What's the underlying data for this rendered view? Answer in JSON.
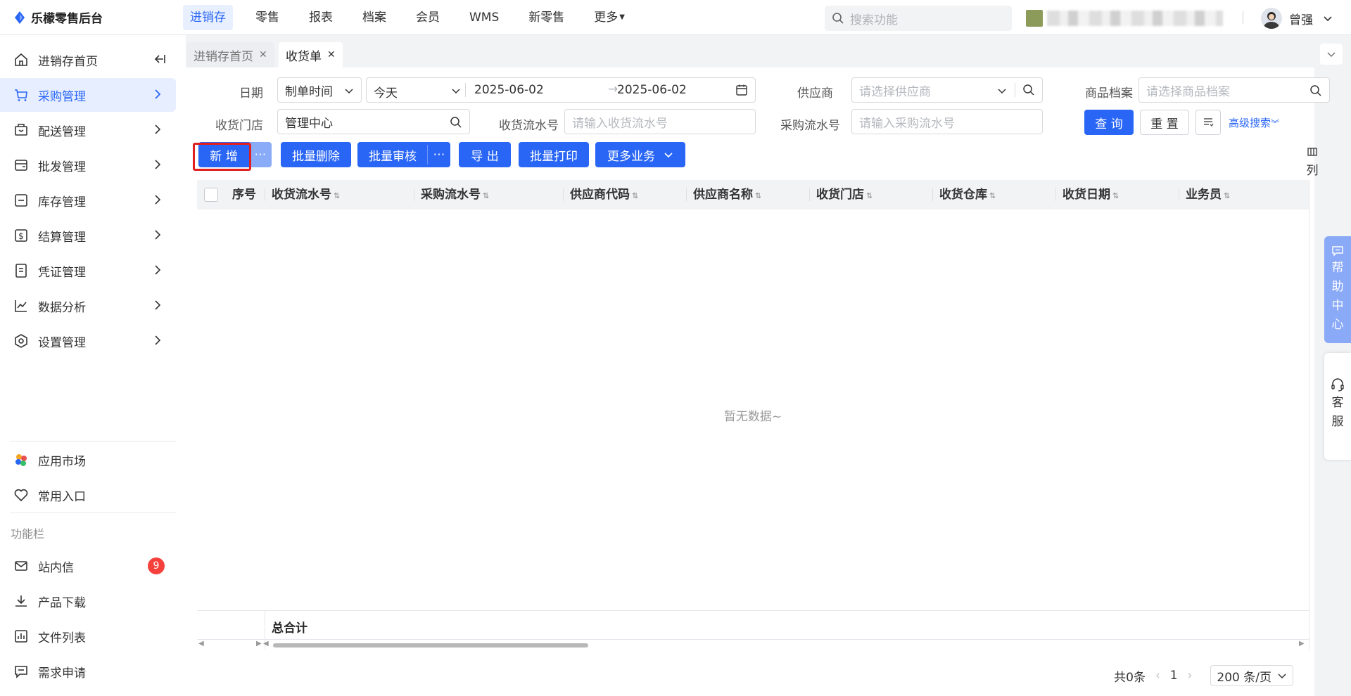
{
  "app": {
    "title": "乐檬零售后台"
  },
  "topnav": [
    {
      "label": "进销存",
      "active": true
    },
    {
      "label": "零售"
    },
    {
      "label": "报表"
    },
    {
      "label": "档案"
    },
    {
      "label": "会员"
    },
    {
      "label": "WMS"
    },
    {
      "label": "新零售"
    },
    {
      "label": "更多",
      "caret": true
    }
  ],
  "search": {
    "placeholder": "搜索功能"
  },
  "user": {
    "name": "曾强"
  },
  "sidebar": {
    "home": "进销存首页",
    "items": [
      {
        "label": "采购管理",
        "icon": "cart-icon",
        "active": true
      },
      {
        "label": "配送管理",
        "icon": "delivery-icon"
      },
      {
        "label": "批发管理",
        "icon": "wallet-icon"
      },
      {
        "label": "库存管理",
        "icon": "inventory-icon"
      },
      {
        "label": "结算管理",
        "icon": "settlement-icon"
      },
      {
        "label": "凭证管理",
        "icon": "voucher-icon"
      },
      {
        "label": "数据分析",
        "icon": "chart-icon"
      },
      {
        "label": "设置管理",
        "icon": "settings-icon"
      }
    ],
    "app_market": "应用市场",
    "favorites": "常用入口",
    "section_title": "功能栏",
    "tools": [
      {
        "label": "站内信",
        "badge": "9"
      },
      {
        "label": "产品下载"
      },
      {
        "label": "文件列表"
      },
      {
        "label": "需求申请"
      }
    ]
  },
  "tabs": [
    {
      "label": "进销存首页",
      "active": false
    },
    {
      "label": "收货单",
      "active": true
    }
  ],
  "filters": {
    "date_label": "日期",
    "date_type": "制单时间",
    "date_range_preset": "今天",
    "date_start": "2025-06-02",
    "date_end": "2025-06-02",
    "supplier_label": "供应商",
    "supplier_placeholder": "请选择供应商",
    "product_label": "商品档案",
    "product_placeholder": "请选择商品档案",
    "store_label": "收货门店",
    "store_value": "管理中心",
    "receipt_no_label": "收货流水号",
    "receipt_no_placeholder": "请输入收货流水号",
    "purchase_no_label": "采购流水号",
    "purchase_no_placeholder": "请输入采购流水号",
    "query_btn": "查 询",
    "reset_btn": "重 置",
    "advanced_search": "高级搜索"
  },
  "actions": {
    "add": "新 增",
    "more_dots": "⋯",
    "batch_delete": "批量删除",
    "batch_audit": "批量审核",
    "export": "导 出",
    "batch_print": "批量打印",
    "more_business": "更多业务"
  },
  "table": {
    "columns": [
      "序号",
      "收货流水号",
      "采购流水号",
      "供应商代码",
      "供应商名称",
      "收货门店",
      "收货仓库",
      "收货日期",
      "业务员"
    ],
    "empty_text": "暂无数据~",
    "total_label": "总合计",
    "column_settings": "列"
  },
  "pagination": {
    "total_text": "共0条",
    "current_page": "1",
    "page_size": "200 条/页"
  },
  "floating": {
    "help_center": [
      "帮",
      "助",
      "中",
      "心"
    ],
    "customer_service": [
      "客",
      "服"
    ]
  },
  "colors": {
    "primary": "#2a66f5",
    "highlight": "#e02020",
    "badge": "#f5403c"
  }
}
